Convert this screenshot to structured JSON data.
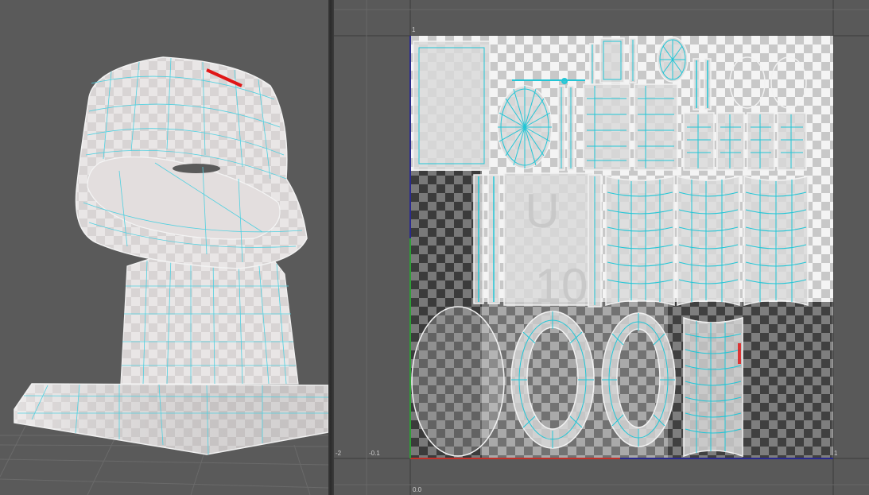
{
  "viewport": {
    "name": "perspective"
  },
  "uv_editor": {
    "axis_labels": {
      "v_one": "1",
      "u_one": "1",
      "minus_two": "-2",
      "minus_point_one": "-0.1",
      "bottom_zero": "0.0"
    },
    "tile_letters": {
      "u": "U",
      "ten": "10"
    }
  },
  "colors": {
    "wire": "#22c6d6",
    "selected_edge": "#e01616",
    "u_axis": "#c0312b",
    "v_axis": "#2d9e36",
    "border_axis": "#2a2a8e",
    "background": "#595959"
  }
}
